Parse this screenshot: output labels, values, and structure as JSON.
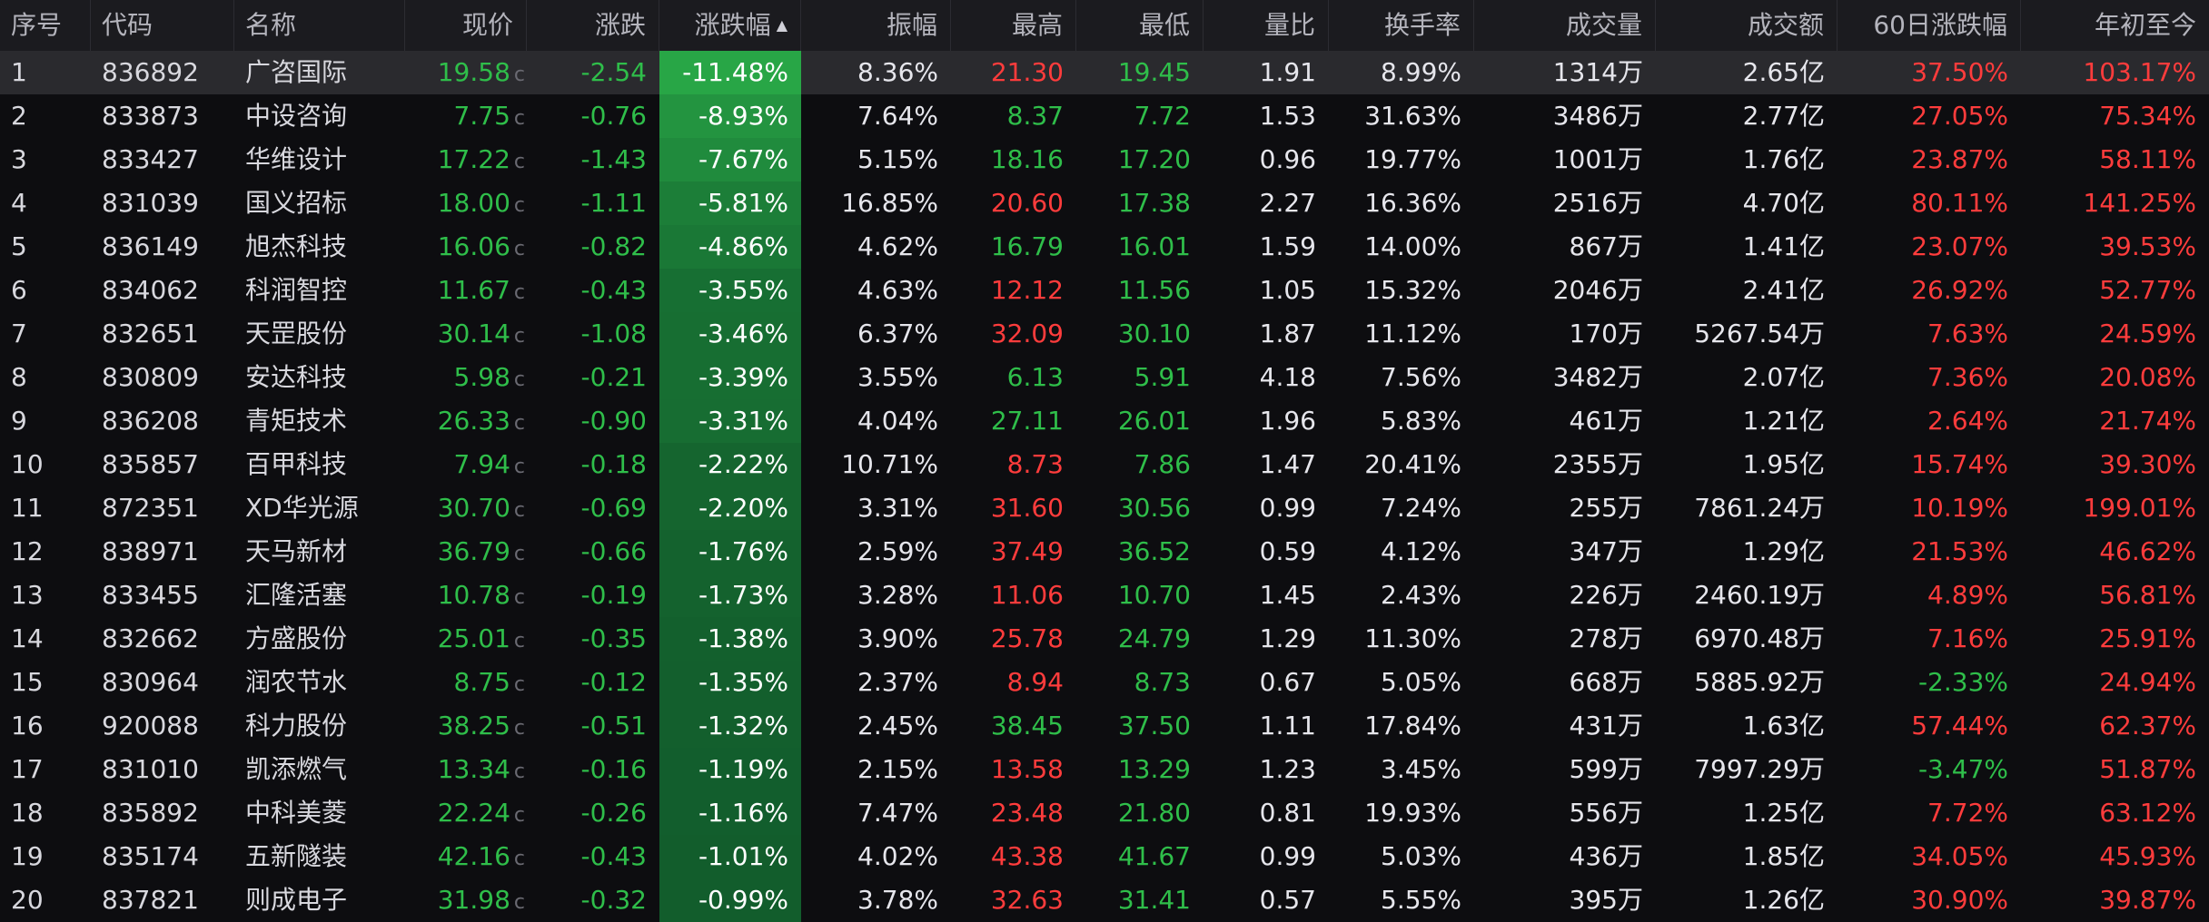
{
  "columns": {
    "idx": "序号",
    "code": "代码",
    "name": "名称",
    "price": "现价",
    "chg": "涨跌",
    "pct": "涨跌幅",
    "amp": "振幅",
    "high": "最高",
    "low": "最低",
    "vr": "量比",
    "turn": "换手率",
    "vol": "成交量",
    "amt": "成交额",
    "d60": "60日涨跌幅",
    "ytd": "年初至今"
  },
  "sort": {
    "column": "涨跌幅",
    "direction": "ascending",
    "icon": "sort-up-icon"
  },
  "price_marker": "c",
  "colors": {
    "up": "#ff3c3c",
    "down": "#2fbe4a",
    "neutral": "#e6e6ec",
    "header_bg": "#1b1b1f",
    "selected_row_bg": "#2a2a2e"
  },
  "selected_row": 1,
  "rows": [
    {
      "idx": "1",
      "code": "836892",
      "name": "广咨国际",
      "price": "19.58",
      "chg": "-2.54",
      "pct": "-11.48%",
      "pct_value": -11.48,
      "amp": "8.36%",
      "high": "21.30",
      "high_dir": "up",
      "low": "19.45",
      "low_dir": "dn",
      "vr": "1.91",
      "turn": "8.99%",
      "vol": "1314万",
      "amt": "2.65亿",
      "d60": "37.50%",
      "d60_dir": "up",
      "ytd": "103.17%",
      "ytd_dir": "up"
    },
    {
      "idx": "2",
      "code": "833873",
      "name": "中设咨询",
      "price": "7.75",
      "chg": "-0.76",
      "pct": "-8.93%",
      "pct_value": -8.93,
      "amp": "7.64%",
      "high": "8.37",
      "high_dir": "dn",
      "low": "7.72",
      "low_dir": "dn",
      "vr": "1.53",
      "turn": "31.63%",
      "vol": "3486万",
      "amt": "2.77亿",
      "d60": "27.05%",
      "d60_dir": "up",
      "ytd": "75.34%",
      "ytd_dir": "up"
    },
    {
      "idx": "3",
      "code": "833427",
      "name": "华维设计",
      "price": "17.22",
      "chg": "-1.43",
      "pct": "-7.67%",
      "pct_value": -7.67,
      "amp": "5.15%",
      "high": "18.16",
      "high_dir": "dn",
      "low": "17.20",
      "low_dir": "dn",
      "vr": "0.96",
      "turn": "19.77%",
      "vol": "1001万",
      "amt": "1.76亿",
      "d60": "23.87%",
      "d60_dir": "up",
      "ytd": "58.11%",
      "ytd_dir": "up"
    },
    {
      "idx": "4",
      "code": "831039",
      "name": "国义招标",
      "price": "18.00",
      "chg": "-1.11",
      "pct": "-5.81%",
      "pct_value": -5.81,
      "amp": "16.85%",
      "high": "20.60",
      "high_dir": "up",
      "low": "17.38",
      "low_dir": "dn",
      "vr": "2.27",
      "turn": "16.36%",
      "vol": "2516万",
      "amt": "4.70亿",
      "d60": "80.11%",
      "d60_dir": "up",
      "ytd": "141.25%",
      "ytd_dir": "up"
    },
    {
      "idx": "5",
      "code": "836149",
      "name": "旭杰科技",
      "price": "16.06",
      "chg": "-0.82",
      "pct": "-4.86%",
      "pct_value": -4.86,
      "amp": "4.62%",
      "high": "16.79",
      "high_dir": "dn",
      "low": "16.01",
      "low_dir": "dn",
      "vr": "1.59",
      "turn": "14.00%",
      "vol": "867万",
      "amt": "1.41亿",
      "d60": "23.07%",
      "d60_dir": "up",
      "ytd": "39.53%",
      "ytd_dir": "up"
    },
    {
      "idx": "6",
      "code": "834062",
      "name": "科润智控",
      "price": "11.67",
      "chg": "-0.43",
      "pct": "-3.55%",
      "pct_value": -3.55,
      "amp": "4.63%",
      "high": "12.12",
      "high_dir": "up",
      "low": "11.56",
      "low_dir": "dn",
      "vr": "1.05",
      "turn": "15.32%",
      "vol": "2046万",
      "amt": "2.41亿",
      "d60": "26.92%",
      "d60_dir": "up",
      "ytd": "52.77%",
      "ytd_dir": "up"
    },
    {
      "idx": "7",
      "code": "832651",
      "name": "天罡股份",
      "price": "30.14",
      "chg": "-1.08",
      "pct": "-3.46%",
      "pct_value": -3.46,
      "amp": "6.37%",
      "high": "32.09",
      "high_dir": "up",
      "low": "30.10",
      "low_dir": "dn",
      "vr": "1.87",
      "turn": "11.12%",
      "vol": "170万",
      "amt": "5267.54万",
      "d60": "7.63%",
      "d60_dir": "up",
      "ytd": "24.59%",
      "ytd_dir": "up"
    },
    {
      "idx": "8",
      "code": "830809",
      "name": "安达科技",
      "price": "5.98",
      "chg": "-0.21",
      "pct": "-3.39%",
      "pct_value": -3.39,
      "amp": "3.55%",
      "high": "6.13",
      "high_dir": "dn",
      "low": "5.91",
      "low_dir": "dn",
      "vr": "4.18",
      "turn": "7.56%",
      "vol": "3482万",
      "amt": "2.07亿",
      "d60": "7.36%",
      "d60_dir": "up",
      "ytd": "20.08%",
      "ytd_dir": "up"
    },
    {
      "idx": "9",
      "code": "836208",
      "name": "青矩技术",
      "price": "26.33",
      "chg": "-0.90",
      "pct": "-3.31%",
      "pct_value": -3.31,
      "amp": "4.04%",
      "high": "27.11",
      "high_dir": "dn",
      "low": "26.01",
      "low_dir": "dn",
      "vr": "1.96",
      "turn": "5.83%",
      "vol": "461万",
      "amt": "1.21亿",
      "d60": "2.64%",
      "d60_dir": "up",
      "ytd": "21.74%",
      "ytd_dir": "up"
    },
    {
      "idx": "10",
      "code": "835857",
      "name": "百甲科技",
      "price": "7.94",
      "chg": "-0.18",
      "pct": "-2.22%",
      "pct_value": -2.22,
      "amp": "10.71%",
      "high": "8.73",
      "high_dir": "up",
      "low": "7.86",
      "low_dir": "dn",
      "vr": "1.47",
      "turn": "20.41%",
      "vol": "2355万",
      "amt": "1.95亿",
      "d60": "15.74%",
      "d60_dir": "up",
      "ytd": "39.30%",
      "ytd_dir": "up"
    },
    {
      "idx": "11",
      "code": "872351",
      "name": "XD华光源",
      "price": "30.70",
      "chg": "-0.69",
      "pct": "-2.20%",
      "pct_value": -2.2,
      "amp": "3.31%",
      "high": "31.60",
      "high_dir": "up",
      "low": "30.56",
      "low_dir": "dn",
      "vr": "0.99",
      "turn": "7.24%",
      "vol": "255万",
      "amt": "7861.24万",
      "d60": "10.19%",
      "d60_dir": "up",
      "ytd": "199.01%",
      "ytd_dir": "up"
    },
    {
      "idx": "12",
      "code": "838971",
      "name": "天马新材",
      "price": "36.79",
      "chg": "-0.66",
      "pct": "-1.76%",
      "pct_value": -1.76,
      "amp": "2.59%",
      "high": "37.49",
      "high_dir": "up",
      "low": "36.52",
      "low_dir": "dn",
      "vr": "0.59",
      "turn": "4.12%",
      "vol": "347万",
      "amt": "1.29亿",
      "d60": "21.53%",
      "d60_dir": "up",
      "ytd": "46.62%",
      "ytd_dir": "up"
    },
    {
      "idx": "13",
      "code": "833455",
      "name": "汇隆活塞",
      "price": "10.78",
      "chg": "-0.19",
      "pct": "-1.73%",
      "pct_value": -1.73,
      "amp": "3.28%",
      "high": "11.06",
      "high_dir": "up",
      "low": "10.70",
      "low_dir": "dn",
      "vr": "1.45",
      "turn": "2.43%",
      "vol": "226万",
      "amt": "2460.19万",
      "d60": "4.89%",
      "d60_dir": "up",
      "ytd": "56.81%",
      "ytd_dir": "up"
    },
    {
      "idx": "14",
      "code": "832662",
      "name": "方盛股份",
      "price": "25.01",
      "chg": "-0.35",
      "pct": "-1.38%",
      "pct_value": -1.38,
      "amp": "3.90%",
      "high": "25.78",
      "high_dir": "up",
      "low": "24.79",
      "low_dir": "dn",
      "vr": "1.29",
      "turn": "11.30%",
      "vol": "278万",
      "amt": "6970.48万",
      "d60": "7.16%",
      "d60_dir": "up",
      "ytd": "25.91%",
      "ytd_dir": "up"
    },
    {
      "idx": "15",
      "code": "830964",
      "name": "润农节水",
      "price": "8.75",
      "chg": "-0.12",
      "pct": "-1.35%",
      "pct_value": -1.35,
      "amp": "2.37%",
      "high": "8.94",
      "high_dir": "up",
      "low": "8.73",
      "low_dir": "dn",
      "vr": "0.67",
      "turn": "5.05%",
      "vol": "668万",
      "amt": "5885.92万",
      "d60": "-2.33%",
      "d60_dir": "dn",
      "ytd": "24.94%",
      "ytd_dir": "up"
    },
    {
      "idx": "16",
      "code": "920088",
      "name": "科力股份",
      "price": "38.25",
      "chg": "-0.51",
      "pct": "-1.32%",
      "pct_value": -1.32,
      "amp": "2.45%",
      "high": "38.45",
      "high_dir": "dn",
      "low": "37.50",
      "low_dir": "dn",
      "vr": "1.11",
      "turn": "17.84%",
      "vol": "431万",
      "amt": "1.63亿",
      "d60": "57.44%",
      "d60_dir": "up",
      "ytd": "62.37%",
      "ytd_dir": "up"
    },
    {
      "idx": "17",
      "code": "831010",
      "name": "凯添燃气",
      "price": "13.34",
      "chg": "-0.16",
      "pct": "-1.19%",
      "pct_value": -1.19,
      "amp": "2.15%",
      "high": "13.58",
      "high_dir": "up",
      "low": "13.29",
      "low_dir": "dn",
      "vr": "1.23",
      "turn": "3.45%",
      "vol": "599万",
      "amt": "7997.29万",
      "d60": "-3.47%",
      "d60_dir": "dn",
      "ytd": "51.87%",
      "ytd_dir": "up"
    },
    {
      "idx": "18",
      "code": "835892",
      "name": "中科美菱",
      "price": "22.24",
      "chg": "-0.26",
      "pct": "-1.16%",
      "pct_value": -1.16,
      "amp": "7.47%",
      "high": "23.48",
      "high_dir": "up",
      "low": "21.80",
      "low_dir": "dn",
      "vr": "0.81",
      "turn": "19.93%",
      "vol": "556万",
      "amt": "1.25亿",
      "d60": "7.72%",
      "d60_dir": "up",
      "ytd": "63.12%",
      "ytd_dir": "up"
    },
    {
      "idx": "19",
      "code": "835174",
      "name": "五新隧装",
      "price": "42.16",
      "chg": "-0.43",
      "pct": "-1.01%",
      "pct_value": -1.01,
      "amp": "4.02%",
      "high": "43.38",
      "high_dir": "up",
      "low": "41.67",
      "low_dir": "dn",
      "vr": "0.99",
      "turn": "5.03%",
      "vol": "436万",
      "amt": "1.85亿",
      "d60": "34.05%",
      "d60_dir": "up",
      "ytd": "45.93%",
      "ytd_dir": "up"
    },
    {
      "idx": "20",
      "code": "837821",
      "name": "则成电子",
      "price": "31.98",
      "chg": "-0.32",
      "pct": "-0.99%",
      "pct_value": -0.99,
      "amp": "3.78%",
      "high": "32.63",
      "high_dir": "up",
      "low": "31.41",
      "low_dir": "dn",
      "vr": "0.57",
      "turn": "5.55%",
      "vol": "395万",
      "amt": "1.26亿",
      "d60": "30.90%",
      "d60_dir": "up",
      "ytd": "39.87%",
      "ytd_dir": "up"
    }
  ]
}
